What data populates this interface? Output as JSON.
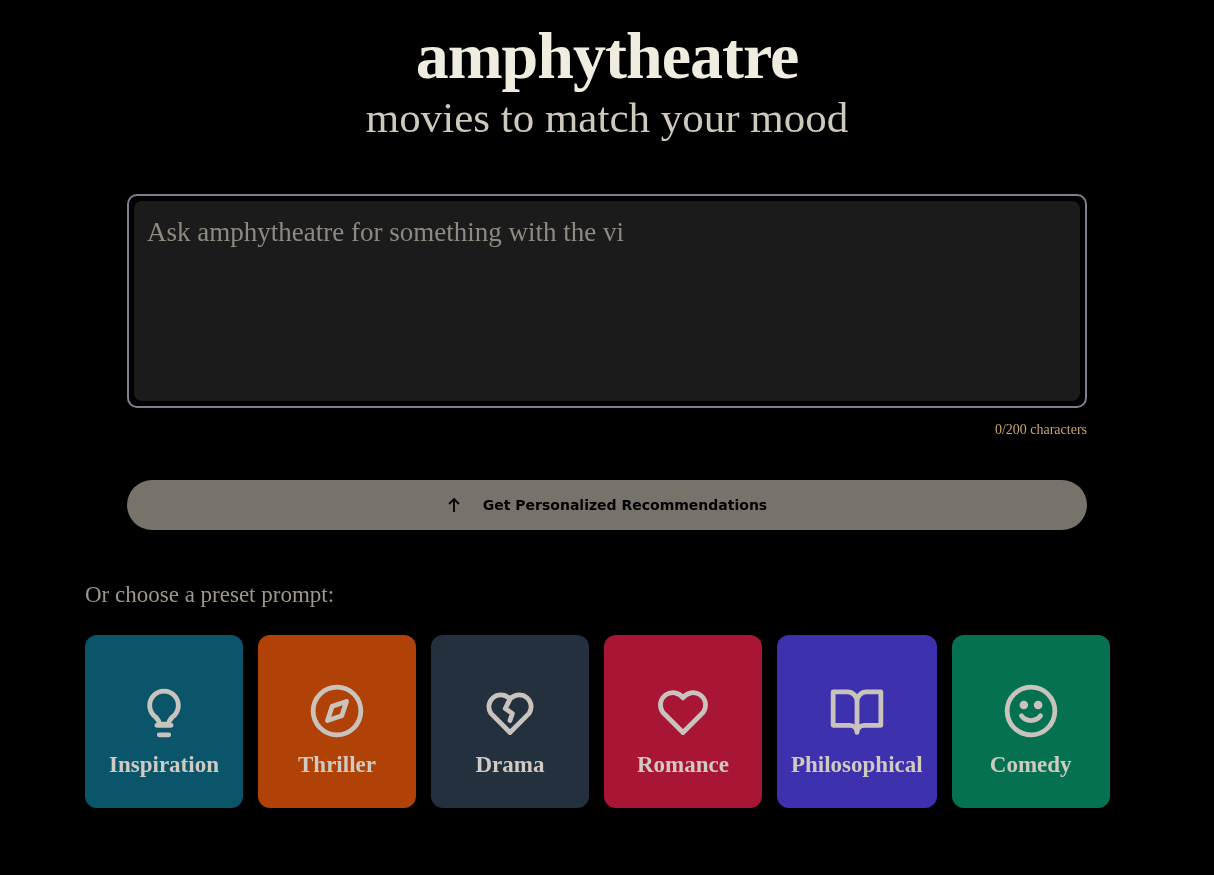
{
  "header": {
    "title": "amphytheatre",
    "subtitle": "movies to match your mood"
  },
  "prompt": {
    "placeholder": "Ask amphytheatre for something with the vi",
    "counter": "0/200 characters"
  },
  "submit": {
    "label": "Get Personalized Recommendations"
  },
  "presets": {
    "heading": "Or choose a preset prompt:",
    "items": [
      {
        "label": "Inspiration",
        "kind": "bulb",
        "color": "#0a5569"
      },
      {
        "label": "Thriller",
        "kind": "compass",
        "color": "#b04208"
      },
      {
        "label": "Drama",
        "kind": "broken-heart",
        "color": "#25303f"
      },
      {
        "label": "Romance",
        "kind": "heart",
        "color": "#a91635"
      },
      {
        "label": "Philosophical",
        "kind": "book",
        "color": "#3d31ad"
      },
      {
        "label": "Comedy",
        "kind": "smile",
        "color": "#067150"
      }
    ]
  }
}
